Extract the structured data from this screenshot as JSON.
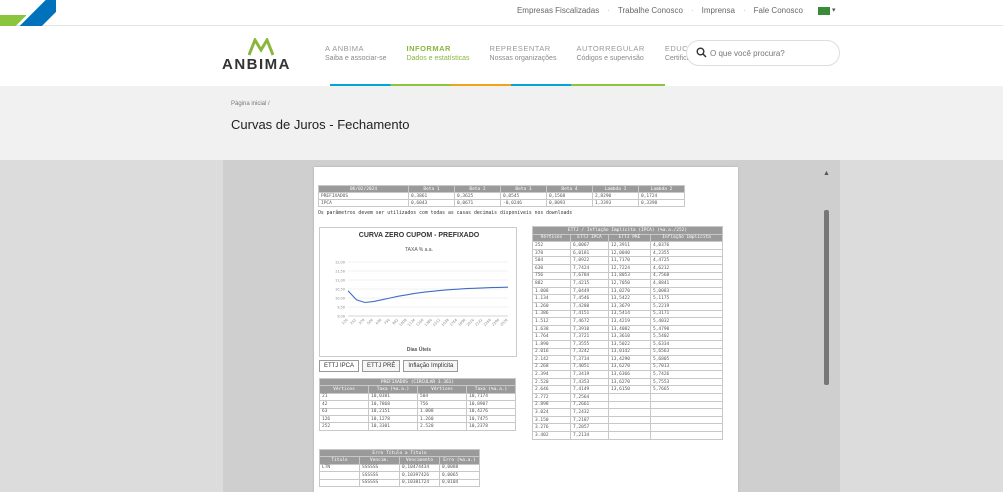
{
  "toplinks": [
    "Empresas Fiscalizadas",
    "Trabalhe Conosco",
    "Imprensa",
    "Fale Conosco"
  ],
  "logo": "ANBIMA",
  "nav": [
    {
      "title": "A ANBIMA",
      "sub": "Saiba e associar-se"
    },
    {
      "title": "INFORMAR",
      "sub": "Dados e estatísticas"
    },
    {
      "title": "REPRESENTAR",
      "sub": "Nossas organizações"
    },
    {
      "title": "AUTORREGULAR",
      "sub": "Códigos e supervisão"
    },
    {
      "title": "EDUCAR",
      "sub": "Certificação e cursos"
    }
  ],
  "search": {
    "placeholder": "O que você procura?"
  },
  "breadcrumb": "Página inicial /",
  "page_title": "Curvas de Juros - Fechamento",
  "params": {
    "header": [
      "06/02/2024",
      "Beta 1",
      "Beta 2",
      "Beta 3",
      "Beta 4",
      "Lambda 1",
      "Lambda 2"
    ],
    "rows": [
      [
        "PREFIXADOS",
        "0,3861",
        "0,3625",
        "0,0545",
        "0,1568",
        "2,8290",
        "0,1724"
      ],
      [
        "IPCA",
        "0,6043",
        "0,0671",
        "-0,0246",
        "0,8093",
        "1,3393",
        "0,3398"
      ]
    ],
    "note": "Os parâmetros devem ser utilizados com todas as casas decimais disponíveis nos downloads"
  },
  "chart_data": {
    "type": "line",
    "title": "CURVA ZERO CUPOM - PREFIXADO",
    "subtitle": "TAXA % a.a.",
    "xlabel": "Dias Úteis",
    "ylabel": "",
    "x": [
      126,
      252,
      378,
      504,
      630,
      756,
      882,
      1008,
      1134,
      1260,
      1386,
      1512,
      1638,
      1764,
      1890,
      2016,
      2142,
      2268,
      2394,
      2520
    ],
    "series": [
      {
        "name": "",
        "values": [
          10.4,
          9.9,
          9.75,
          9.8,
          9.9,
          10.0,
          10.1,
          10.18,
          10.26,
          10.32,
          10.37,
          10.42,
          10.46,
          10.49,
          10.52,
          10.54,
          10.56,
          10.58,
          10.59,
          10.6
        ]
      }
    ],
    "ylim": [
      9.0,
      12.0
    ],
    "grid": true
  },
  "tabs": [
    "ETTJ IPCA",
    "ETTJ PRÉ",
    "Inflação Implícita"
  ],
  "tableA": {
    "caption": "PREFIXADOS (CIRCULAR 3.361)",
    "header": [
      "Vértices",
      "Taxa (%a.a.)",
      "Vértices",
      "Taxa (%a.a.)"
    ],
    "rows": [
      [
        "21",
        "10,0381",
        "504",
        "10,7174"
      ],
      [
        "42",
        "10,7868",
        "756",
        "10,8907"
      ],
      [
        "63",
        "10,2151",
        "1.008",
        "10,4276"
      ],
      [
        "126",
        "10,1278",
        "1.260",
        "10,7475"
      ],
      [
        "252",
        "10,3301",
        "2.520",
        "10,2378"
      ]
    ]
  },
  "tableB": {
    "caption": "Erro Título a Título",
    "header": [
      "Título",
      "Vencim.",
      "Vencimento",
      "Erro (%a.a.)"
    ],
    "rows": [
      [
        "LTN",
        "SSSSSS",
        "0,10474434",
        "0,0088"
      ],
      [
        "",
        "SSSSSS",
        "0,10397426",
        "0,0065"
      ],
      [
        "",
        "SSSSSS",
        "0,10381724",
        "0,0104"
      ]
    ]
  },
  "tableR": {
    "caption": "ETTJ / Inflação Implícita (IPCA) (%a.a./252)",
    "header": [
      "Vértices",
      "ETTJ IPCA",
      "ETTJ PRÉ",
      "Inflação Implícita"
    ],
    "rows": [
      [
        "252",
        "6,0067",
        "12,3911",
        "4,0376"
      ],
      [
        "378",
        "6,0181",
        "12,0040",
        "4,2355"
      ],
      [
        "504",
        "7,0922",
        "11,7170",
        "4,4725"
      ],
      [
        "630",
        "7,7424",
        "12,7224",
        "4,6212"
      ],
      [
        "756",
        "7,6784",
        "11,8053",
        "4,7568"
      ],
      [
        "882",
        "7,4215",
        "12,7050",
        "4,8841"
      ],
      [
        "1.008",
        "7,0449",
        "13,0270",
        "5,0083"
      ],
      [
        "1.134",
        "7,4546",
        "13,5422",
        "5,1175"
      ],
      [
        "1.260",
        "7,4280",
        "13,3679",
        "5,2219"
      ],
      [
        "1.386",
        "7,4151",
        "13,5414",
        "5,3171"
      ],
      [
        "1.512",
        "7,4672",
        "13,4219",
        "5,4032"
      ],
      [
        "1.638",
        "7,3910",
        "13,4082",
        "5,4790"
      ],
      [
        "1.764",
        "7,3721",
        "13,3610",
        "5,5402"
      ],
      [
        "1.890",
        "7,3555",
        "13,5022",
        "5,6334"
      ],
      [
        "2.016",
        "7,3242",
        "13,0142",
        "5,6563"
      ],
      [
        "2.142",
        "7,3734",
        "13,4290",
        "5,6805"
      ],
      [
        "2.268",
        "7,4051",
        "13,6270",
        "5,7013"
      ],
      [
        "2.394",
        "7,3419",
        "13,6366",
        "5,7426"
      ],
      [
        "2.520",
        "7,4353",
        "13,6270",
        "5,7553"
      ],
      [
        "2.646",
        "7,4149",
        "13,6150",
        "5,7665"
      ],
      [
        "2.772",
        "7,2564",
        "",
        ""
      ],
      [
        "2.898",
        "7,2661",
        "",
        ""
      ],
      [
        "3.024",
        "7,2432",
        "",
        ""
      ],
      [
        "3.150",
        "7,2187",
        "",
        ""
      ],
      [
        "3.276",
        "7,2057",
        "",
        ""
      ],
      [
        "3.402",
        "7,2134",
        "",
        ""
      ]
    ]
  }
}
